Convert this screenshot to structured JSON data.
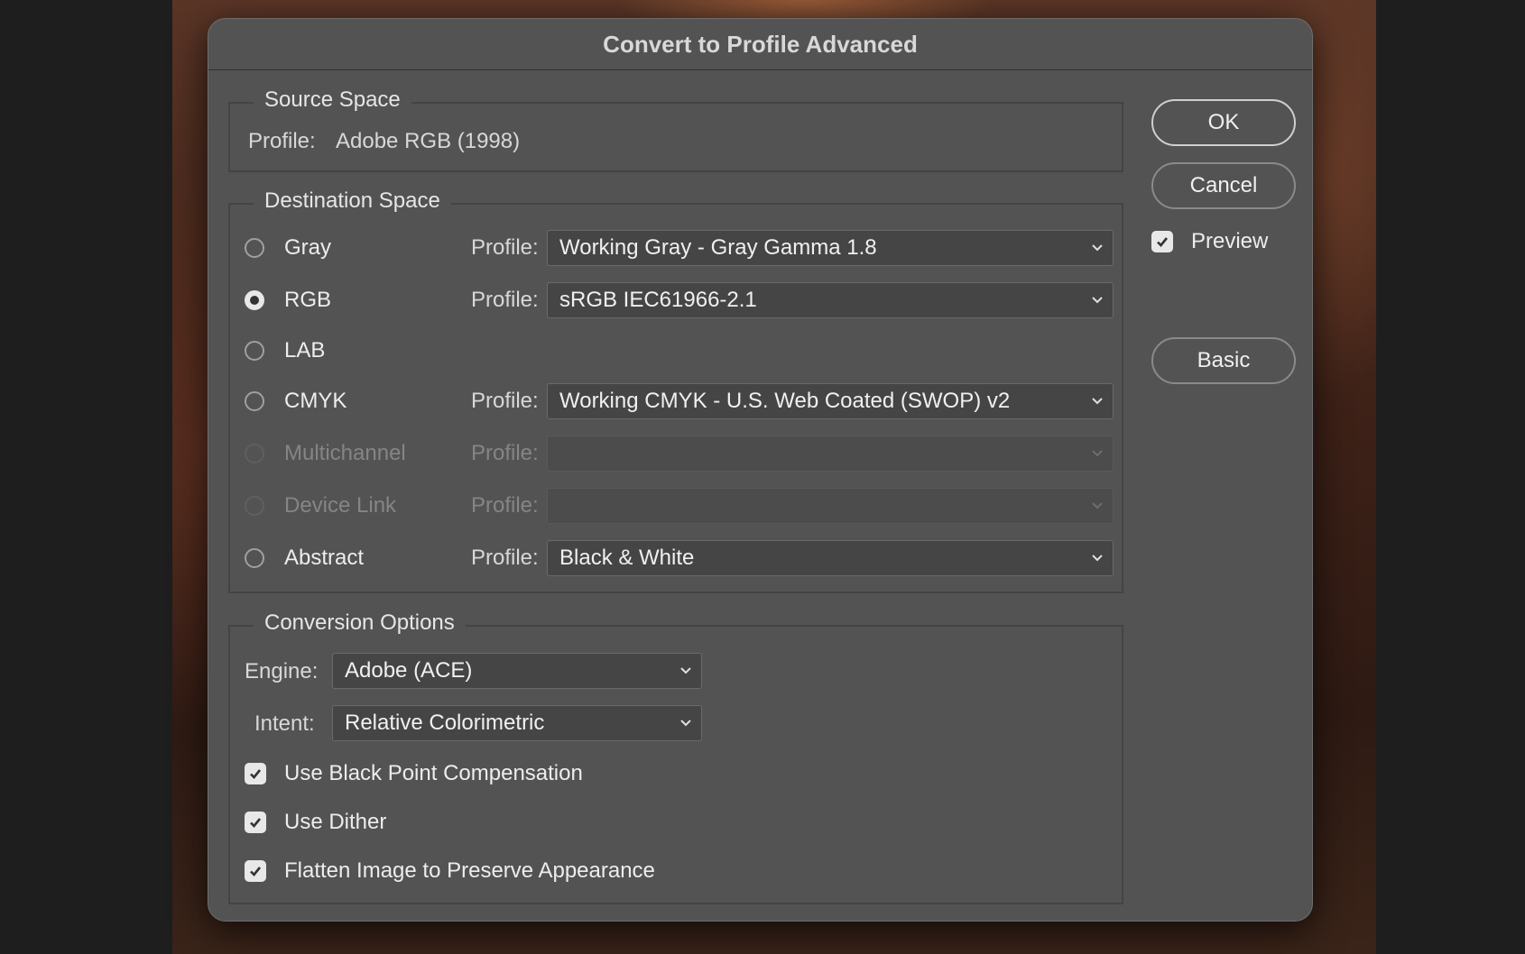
{
  "dialog": {
    "title": "Convert to Profile Advanced"
  },
  "source_space": {
    "title": "Source Space",
    "profile_label": "Profile:",
    "profile_value": "Adobe RGB (1998)"
  },
  "destination_space": {
    "title": "Destination Space",
    "profile_label": "Profile:",
    "modes": [
      {
        "label": "Gray",
        "selected": false,
        "enabled": true,
        "profile": "Working Gray - Gray Gamma 1.8"
      },
      {
        "label": "RGB",
        "selected": true,
        "enabled": true,
        "profile": "sRGB IEC61966-2.1"
      },
      {
        "label": "LAB",
        "selected": false,
        "enabled": true,
        "profile": null
      },
      {
        "label": "CMYK",
        "selected": false,
        "enabled": true,
        "profile": "Working CMYK - U.S. Web Coated (SWOP) v2"
      },
      {
        "label": "Multichannel",
        "selected": false,
        "enabled": false,
        "profile": ""
      },
      {
        "label": "Device Link",
        "selected": false,
        "enabled": false,
        "profile": ""
      },
      {
        "label": "Abstract",
        "selected": false,
        "enabled": true,
        "profile": "Black & White"
      }
    ]
  },
  "conversion_options": {
    "title": "Conversion Options",
    "engine_label": "Engine:",
    "engine_value": "Adobe (ACE)",
    "intent_label": "Intent:",
    "intent_value": "Relative Colorimetric",
    "checkboxes": [
      {
        "label": "Use Black Point Compensation",
        "checked": true
      },
      {
        "label": "Use Dither",
        "checked": true
      },
      {
        "label": "Flatten Image to Preserve Appearance",
        "checked": true
      }
    ]
  },
  "buttons": {
    "ok": "OK",
    "cancel": "Cancel",
    "basic": "Basic"
  },
  "preview": {
    "label": "Preview",
    "checked": true
  },
  "icons": {
    "chevron": "chevron-down-icon",
    "check": "checkmark-icon"
  }
}
